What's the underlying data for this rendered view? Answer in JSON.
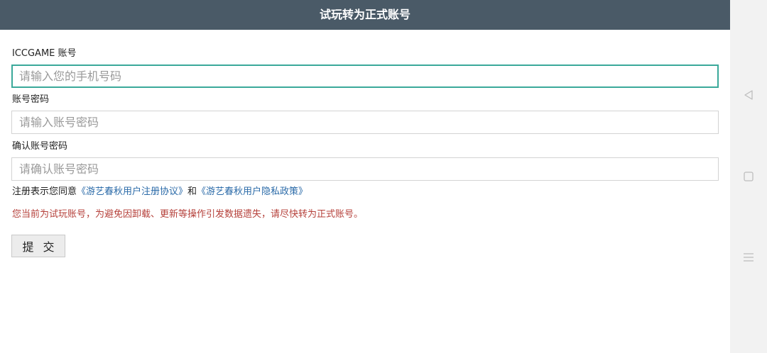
{
  "header": {
    "title": "试玩转为正式账号"
  },
  "form": {
    "account_label": "ICCGAME 账号",
    "account_placeholder": "请输入您的手机号码",
    "password_label": "账号密码",
    "password_placeholder": "请输入账号密码",
    "confirm_label": "确认账号密码",
    "confirm_placeholder": "请确认账号密码",
    "agreement_prefix": "注册表示您同意",
    "agreement_link_1": "《游艺春秋用户注册协议》",
    "agreement_and": "和",
    "agreement_link_2": "《游艺春秋用户隐私政策》",
    "warning": "您当前为试玩账号，为避免因卸载、更新等操作引发数据遗失，请尽快转为正式账号。",
    "submit_label": "提 交"
  },
  "navbar": {
    "icons": [
      "back-icon",
      "home-icon",
      "menu-icon"
    ]
  },
  "colors": {
    "header_bg": "#4a5a67",
    "focus_border": "#3aa99a",
    "link": "#2a6aa8",
    "warning": "#b5403a"
  }
}
